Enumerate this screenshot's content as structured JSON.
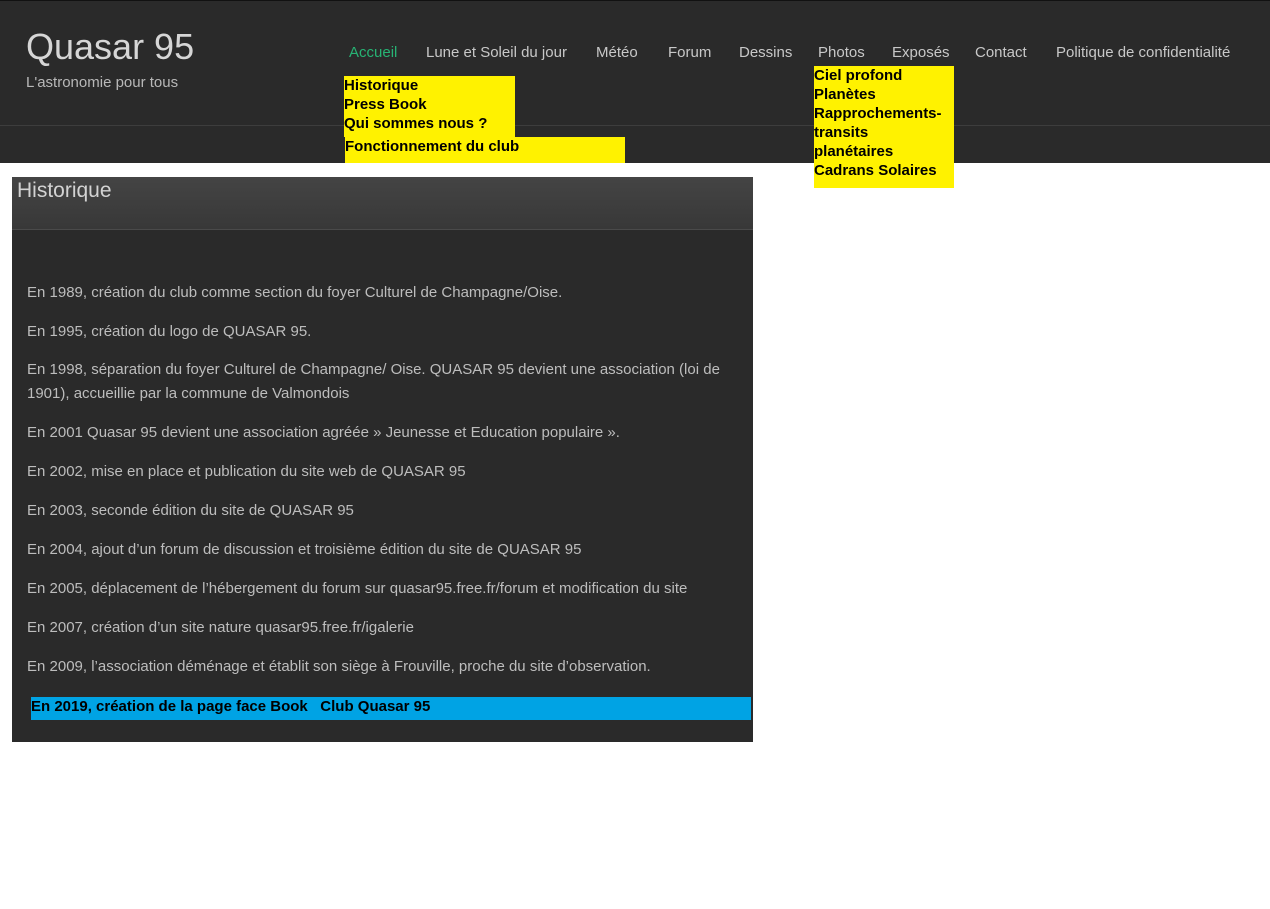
{
  "site": {
    "title": "Quasar 95",
    "tagline": "L'astronomie pour tous"
  },
  "nav": {
    "items": [
      {
        "label": "Accueil",
        "active": true
      },
      {
        "label": "Lune et Soleil du jour"
      },
      {
        "label": "Météo"
      },
      {
        "label": "Forum"
      },
      {
        "label": "Dessins"
      },
      {
        "label": "Photos"
      },
      {
        "label": "Exposés"
      },
      {
        "label": "Contact"
      },
      {
        "label": "Politique de confidentialité"
      }
    ],
    "active_color": "#27b374"
  },
  "accueil_menu": [
    "Historique",
    "Press Book",
    "Qui sommes nous ?",
    "Fonctionnement du club"
  ],
  "photos_menu": [
    "Ciel profond",
    "Planètes",
    "Rapprochements-",
    "transits",
    "planétaires",
    "Cadrans Solaires"
  ],
  "dropdown_color": "#fff200",
  "content": {
    "heading": "Historique",
    "paragraphs": [
      "En 1989, création du club comme section du foyer Culturel de Champagne/Oise.",
      "En 1995, création du logo de QUASAR 95.",
      "En 1998, séparation du foyer Culturel de Champagne/ Oise.  QUASAR 95 devient une association (loi de 1901), accueillie par la commune de Valmondois",
      "En 2001 Quasar 95 devient une association agréée  » Jeunesse et Education populaire ».",
      "En 2002, mise en place et publication du site web de QUASAR 95",
      "En 2003, seconde édition du site de QUASAR 95",
      "En 2004, ajout d’un forum de discussion et troisième édition du site de QUASAR 95",
      "En 2005, déplacement de l’hébergement du forum sur quasar95.free.fr/forum et modification du site",
      "En 2007, création d’un site nature quasar95.free.fr/igalerie",
      "En 2009, l’association déménage et établit son siège à Frouville, proche du site d’observation."
    ],
    "highlight": "En 2019, création de la page face Book   Club Quasar 95",
    "highlight_color": "#00a3e4"
  }
}
